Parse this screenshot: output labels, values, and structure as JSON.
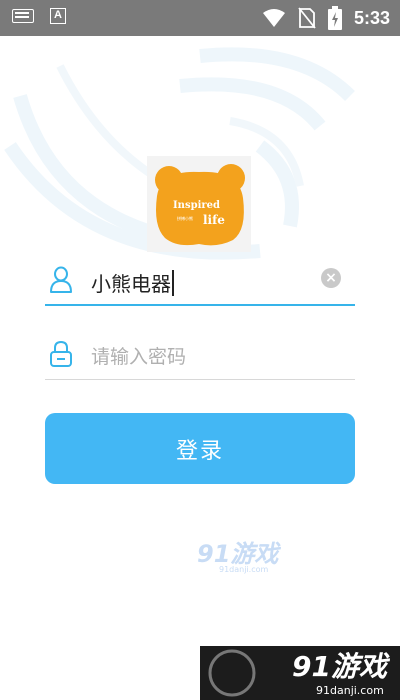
{
  "status_bar": {
    "time": "5:33",
    "left_icons": [
      "keyboard-icon",
      "a-icon"
    ],
    "right_icons": [
      "wifi-icon",
      "no-sim-icon",
      "battery-icon"
    ]
  },
  "logo": {
    "line1": "Inspired",
    "line2": "life",
    "small_text": "拼搏小熊"
  },
  "form": {
    "username_value": "小熊电器",
    "password_placeholder": "请输入密码",
    "login_label": "登录"
  },
  "watermark": {
    "center_logo": "91游戏",
    "center_url": "91danji.com",
    "bottom_logo": "91游戏",
    "bottom_url": "91danji.com"
  },
  "colors": {
    "accent": "#43b7f4",
    "underline_active": "#36b4ea",
    "status_bar": "#7a7a7a",
    "logo_bg": "#f3a21d"
  }
}
